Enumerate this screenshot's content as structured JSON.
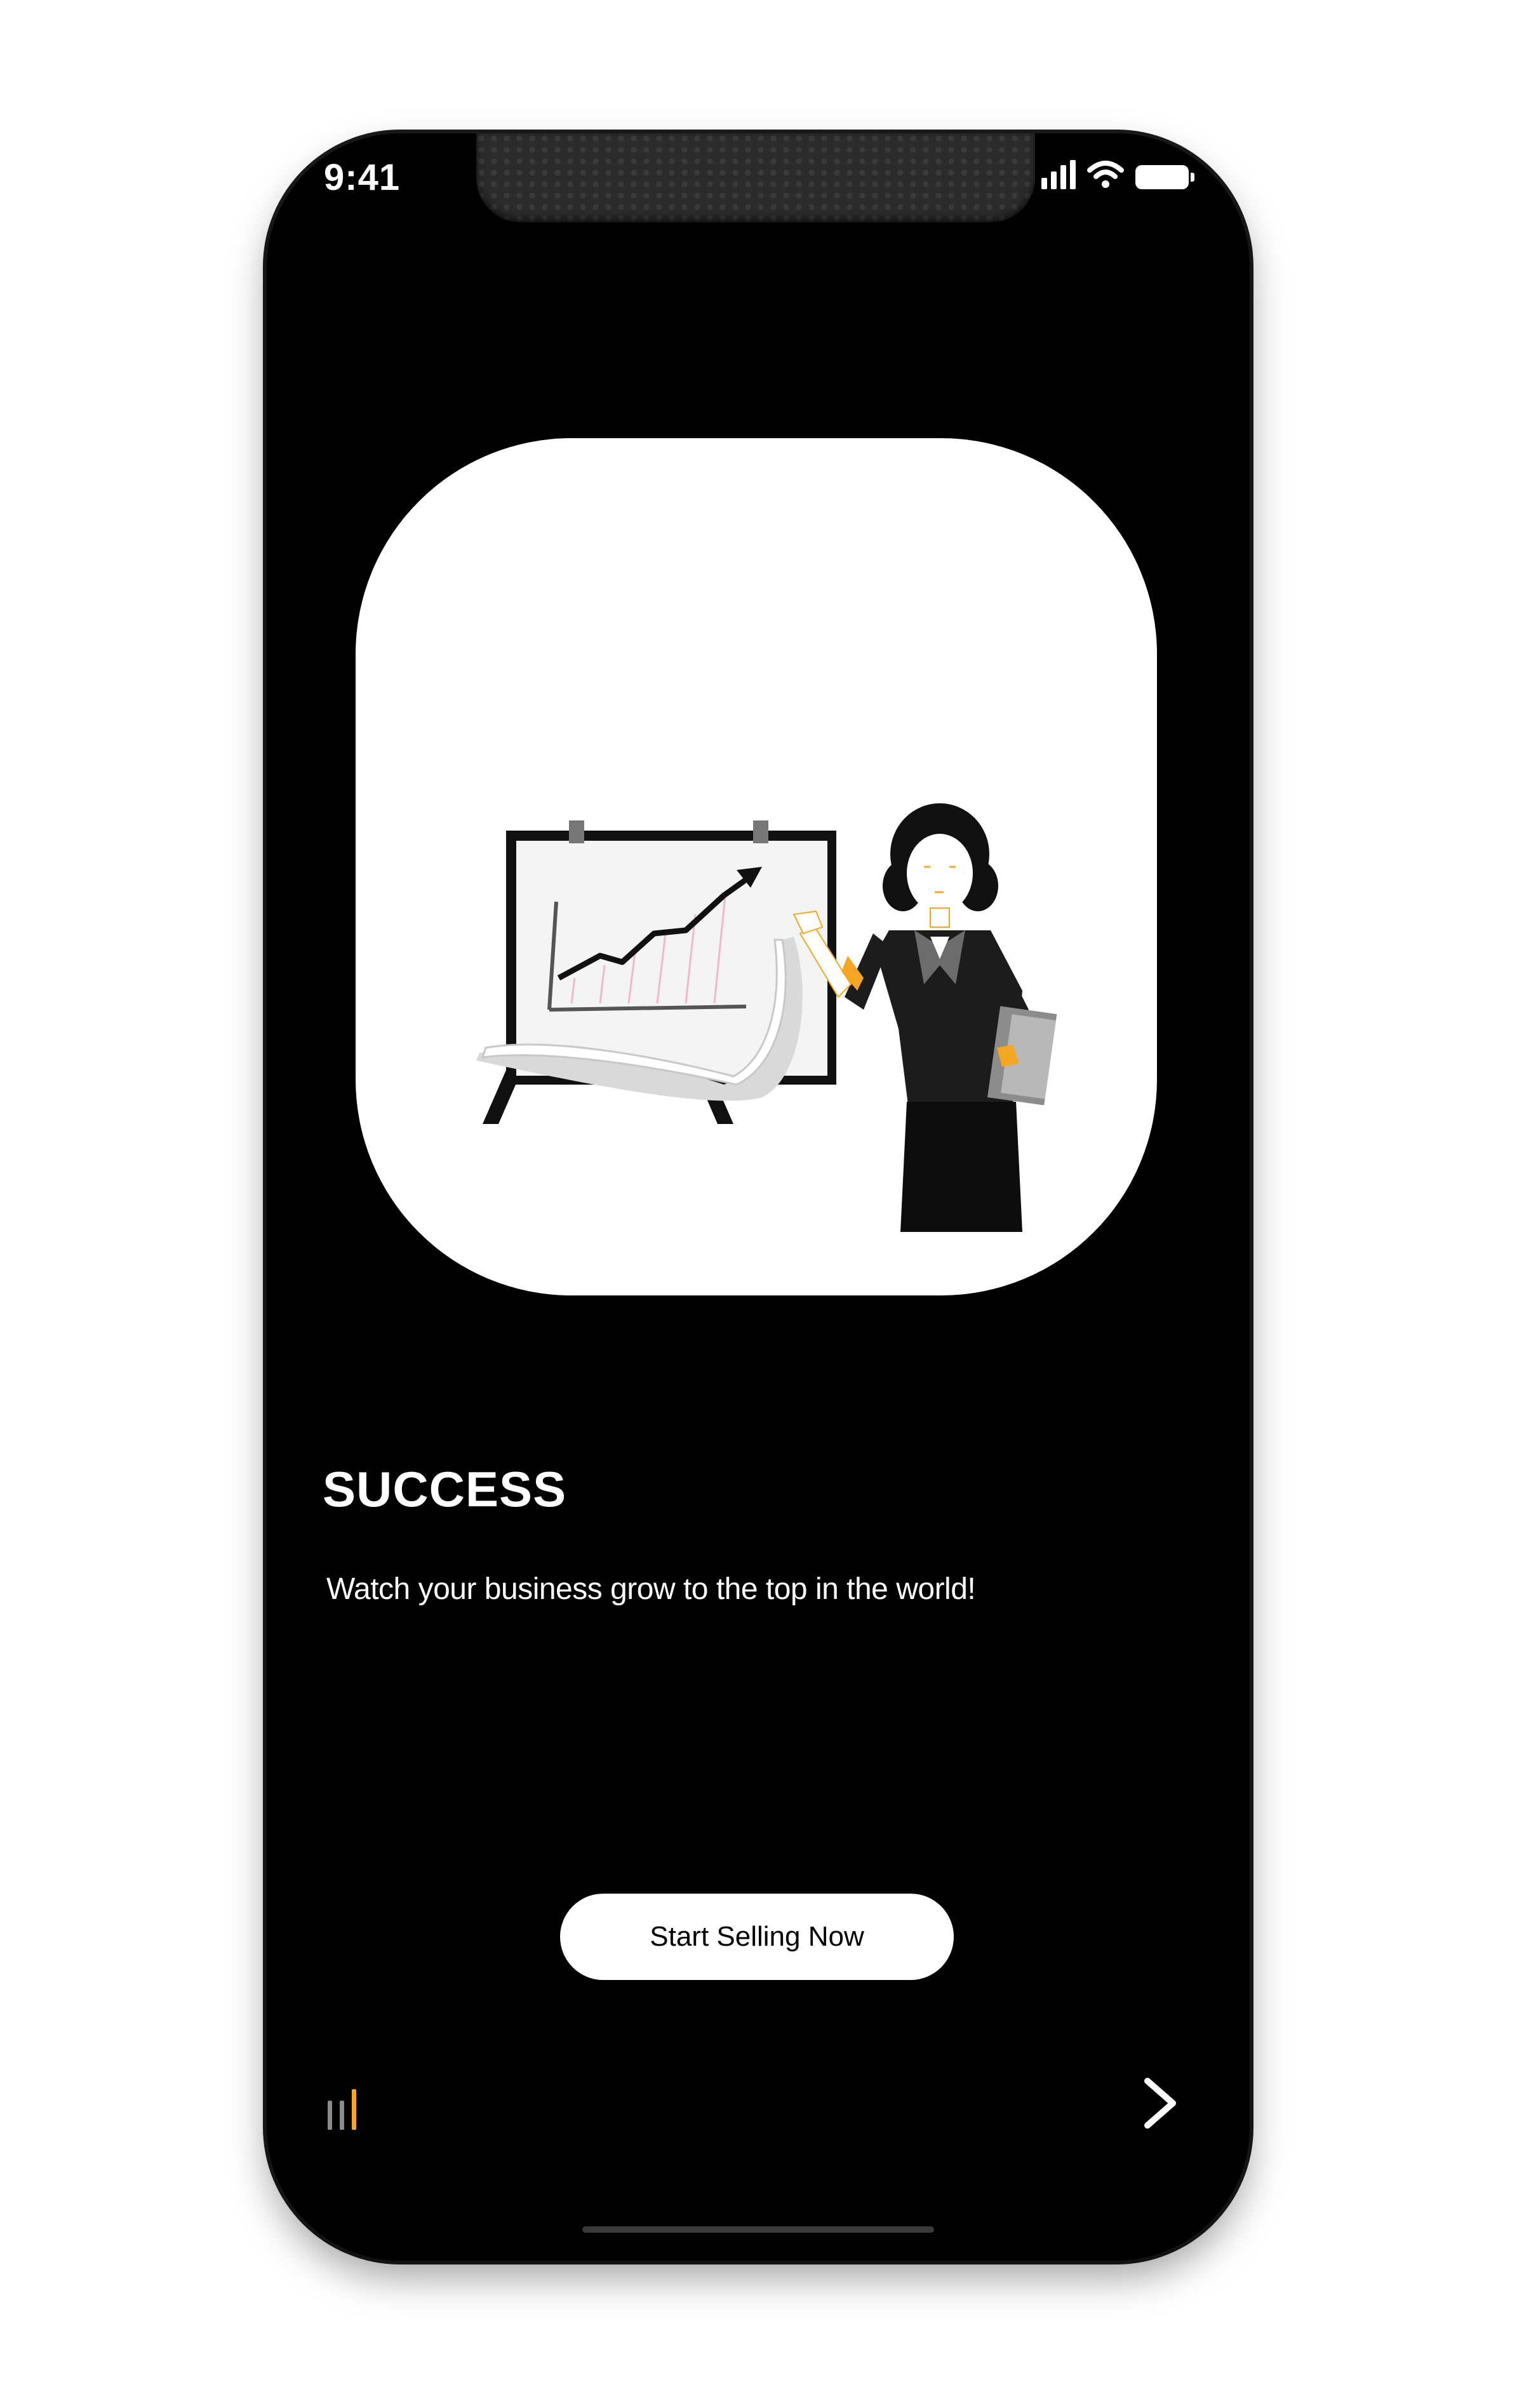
{
  "status_bar": {
    "time": "9:41",
    "icons": [
      "signal-icon",
      "wifi-icon",
      "battery-icon"
    ]
  },
  "onboarding": {
    "illustration": "presentation-chart-illustration",
    "title": "SUCCESS",
    "description": "Watch your business grow to the top in the world!",
    "cta_label": "Start Selling Now",
    "page_indicator": {
      "pages": 3,
      "current_index": 2,
      "active_color": "#F5A623",
      "inactive_color": "#8a8a8a"
    },
    "next_icon": "chevron-right-icon"
  },
  "colors": {
    "background": "#000000",
    "card": "#ffffff",
    "accent": "#F5A623"
  }
}
